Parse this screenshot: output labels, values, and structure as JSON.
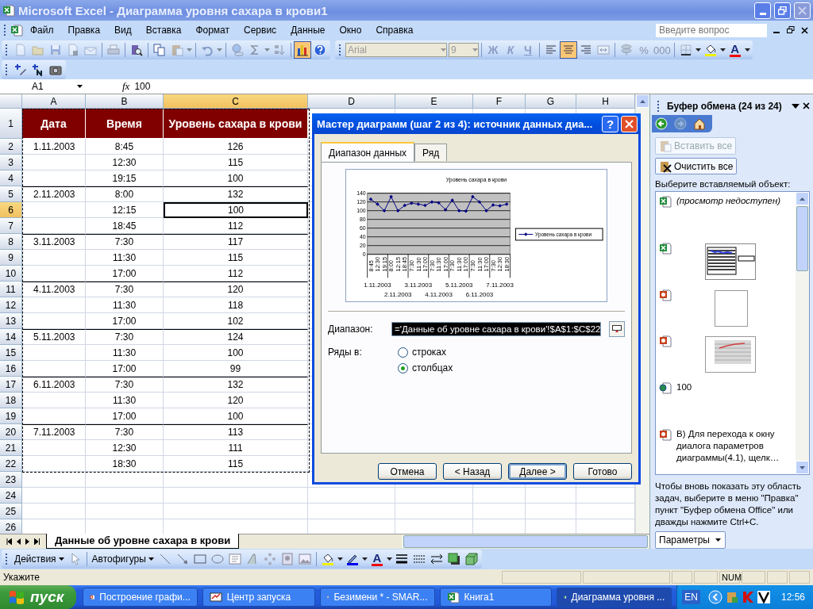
{
  "window": {
    "title": "Microsoft Excel - Диаграмма уровня сахара в крови1"
  },
  "menu": {
    "items": [
      "Файл",
      "Правка",
      "Вид",
      "Вставка",
      "Формат",
      "Сервис",
      "Данные",
      "Окно",
      "Справка"
    ],
    "help_search": {
      "placeholder": "Введите вопрос"
    }
  },
  "standard_toolbar": {
    "groups": [
      [
        {
          "kind": "new",
          "pressed": false,
          "disabled": true
        },
        {
          "kind": "open",
          "pressed": false,
          "disabled": true
        },
        {
          "kind": "save",
          "pressed": false,
          "disabled": true
        },
        {
          "kind": "permission",
          "pressed": false,
          "disabled": true
        },
        {
          "kind": "email",
          "pressed": false,
          "disabled": true
        }
      ],
      [
        {
          "kind": "print",
          "pressed": false,
          "disabled": true
        }
      ],
      [
        {
          "kind": "research",
          "pressed": false,
          "disabled": false
        }
      ],
      [
        {
          "kind": "copy",
          "pressed": false,
          "disabled": false
        },
        {
          "kind": "paste",
          "pressed": false,
          "disabled": true
        },
        {
          "kind": "caret",
          "pressed": false,
          "disabled": true
        }
      ],
      [
        {
          "kind": "undo",
          "pressed": false,
          "disabled": true
        },
        {
          "kind": "caret",
          "pressed": false,
          "disabled": true
        }
      ],
      [
        {
          "kind": "link",
          "pressed": false,
          "disabled": true
        },
        {
          "kind": "sum",
          "pressed": false,
          "disabled": true
        },
        {
          "kind": "caret",
          "pressed": false,
          "disabled": true
        },
        {
          "kind": "sort",
          "pressed": false,
          "disabled": true
        }
      ],
      [
        {
          "kind": "chart",
          "pressed": true,
          "disabled": false
        },
        {
          "kind": "help",
          "pressed": false,
          "disabled": false
        }
      ]
    ]
  },
  "formatting_toolbar": {
    "font": {
      "value": "Arial",
      "disabled": true
    },
    "size": {
      "value": "9",
      "disabled": true
    },
    "groups": [
      [
        {
          "kind": "bold",
          "label": "Ж",
          "pressed": false,
          "disabled": true
        },
        {
          "kind": "italic",
          "label": "К",
          "pressed": false,
          "disabled": true
        },
        {
          "kind": "underline",
          "label": "Ч",
          "pressed": false,
          "disabled": true
        }
      ],
      [
        {
          "kind": "align-left",
          "pressed": false,
          "disabled": false
        },
        {
          "kind": "align-center",
          "pressed": true,
          "disabled": false
        },
        {
          "kind": "align-right",
          "pressed": false,
          "disabled": false
        },
        {
          "kind": "merge",
          "pressed": false,
          "disabled": true
        }
      ],
      [
        {
          "kind": "currency",
          "pressed": false,
          "disabled": true
        },
        {
          "kind": "percent",
          "label": "%",
          "pressed": false,
          "disabled": true
        },
        {
          "kind": "thousands",
          "label": "000",
          "pressed": false,
          "disabled": true
        }
      ],
      [
        {
          "kind": "borders",
          "pressed": false,
          "disabled": false
        },
        {
          "kind": "caret",
          "pressed": false,
          "disabled": false
        },
        {
          "kind": "fill",
          "pressed": false,
          "disabled": false
        },
        {
          "kind": "caret",
          "pressed": false,
          "disabled": false
        },
        {
          "kind": "font-color",
          "label": "A",
          "pressed": false,
          "disabled": false
        },
        {
          "kind": "caret",
          "pressed": false,
          "disabled": false
        }
      ]
    ]
  },
  "review_toolbar": {
    "items": [
      {
        "kind": "pen-plus"
      },
      {
        "kind": "note-plus"
      },
      {
        "kind": "camera"
      }
    ]
  },
  "formula_bar": {
    "name_box": "A1",
    "fx": "fx",
    "value": "100"
  },
  "sheet": {
    "columns": [
      "A",
      "B",
      "C",
      "D",
      "E",
      "F",
      "G",
      "H"
    ],
    "row_numbers": [
      "1",
      "2",
      "3",
      "4",
      "5",
      "6",
      "7",
      "8",
      "9",
      "10",
      "11",
      "12",
      "13",
      "14",
      "15",
      "16",
      "17",
      "18",
      "19",
      "20",
      "21",
      "22",
      "23",
      "24",
      "25",
      "26"
    ],
    "header": [
      "Дата",
      "Время",
      "Уровень сахара в крови"
    ],
    "data": [
      {
        "date": "1.11.2003",
        "time": "8:45",
        "sugar": "126",
        "selected": false
      },
      {
        "time": "12:30",
        "sugar": "115",
        "selected": false
      },
      {
        "time": "19:15",
        "sugar": "100",
        "selected": false
      },
      {
        "date": "2.11.2003",
        "time": "8:00",
        "sugar": "132",
        "selected": false
      },
      {
        "time": "12:15",
        "sugar": "100",
        "selected": true
      },
      {
        "time": "18:45",
        "sugar": "112",
        "selected": false
      },
      {
        "date": "3.11.2003",
        "time": "7:30",
        "sugar": "117",
        "selected": false
      },
      {
        "time": "11:30",
        "sugar": "115",
        "selected": false
      },
      {
        "time": "17:00",
        "sugar": "112",
        "selected": false
      },
      {
        "date": "4.11.2003",
        "time": "7:30",
        "sugar": "120",
        "selected": false
      },
      {
        "time": "11:30",
        "sugar": "118",
        "selected": false
      },
      {
        "time": "17:00",
        "sugar": "102",
        "selected": false
      },
      {
        "date": "5.11.2003",
        "time": "7:30",
        "sugar": "124",
        "selected": false
      },
      {
        "time": "11:30",
        "sugar": "100",
        "selected": false
      },
      {
        "time": "17:00",
        "sugar": "99",
        "selected": false
      },
      {
        "date": "6.11.2003",
        "time": "7:30",
        "sugar": "132",
        "selected": false
      },
      {
        "time": "11:30",
        "sugar": "120",
        "selected": false
      },
      {
        "time": "17:00",
        "sugar": "100",
        "selected": false
      },
      {
        "date": "7.11.2003",
        "time": "7:30",
        "sugar": "113",
        "selected": false
      },
      {
        "time": "12:30",
        "sugar": "111",
        "selected": false
      },
      {
        "time": "18:30",
        "sugar": "115",
        "selected": false
      }
    ],
    "copy_marquee": true,
    "tabs": [
      {
        "label": "Данные об уровне сахара в крови",
        "selected": true
      }
    ]
  },
  "dialog": {
    "title": "Мастер диаграмм (шаг 2 из 4): источник данных диа...",
    "help": "?",
    "tabs": [
      {
        "label": "Диапазон данных",
        "selected": true
      },
      {
        "label": "Ряд",
        "selected": false
      }
    ],
    "chart_data": {
      "type": "line",
      "title": "Уровень сахара в крови",
      "categories": [
        "8:45",
        "12:30",
        "19:15",
        "8:00",
        "12:15",
        "18:45",
        "7:30",
        "11:30",
        "17:00",
        "7:30",
        "11:30",
        "17:00",
        "7:30",
        "11:30",
        "17:00",
        "7:30",
        "11:30",
        "17:00",
        "7:30",
        "12:30",
        "18:30"
      ],
      "grid": true,
      "series": [
        {
          "name": "Уровень сахара в крови",
          "color": "#000080",
          "marker": "diamond",
          "values": [
            126,
            115,
            100,
            132,
            100,
            112,
            117,
            115,
            112,
            120,
            118,
            102,
            124,
            100,
            99,
            132,
            120,
            100,
            113,
            111,
            115
          ]
        }
      ],
      "ylim": [
        0,
        140
      ],
      "yticks": [
        0,
        20,
        40,
        60,
        80,
        100,
        120,
        140
      ]
    },
    "date_labels": [
      "1.11.2003",
      "2.11.2003",
      "3.11.2003",
      "4.11.2003",
      "5.11.2003",
      "6.11.2003",
      "7.11.2003"
    ],
    "range_label": "Диапазон:",
    "range_value": "='Данные об уровне сахара в крови'!$A$1:$C$22",
    "series_in_label": "Ряды в:",
    "series_in": [
      {
        "label": "строках",
        "selected": false
      },
      {
        "label": "столбцах",
        "selected": true
      }
    ],
    "buttons": [
      {
        "label": "Отмена",
        "focused": false
      },
      {
        "label": "< Назад",
        "focused": false
      },
      {
        "label": "Далее >",
        "focused": true
      },
      {
        "label": "Готово",
        "focused": false
      }
    ]
  },
  "task_pane": {
    "title": "Буфер обмена (24 из 24)",
    "nav": [
      {
        "kind": "back",
        "disabled": false
      },
      {
        "kind": "forward",
        "disabled": true
      },
      {
        "kind": "home",
        "disabled": false
      }
    ],
    "buttons": [
      {
        "kind": "paste",
        "label": "Вставить все",
        "disabled": true
      },
      {
        "kind": "clear",
        "label": "Очистить все",
        "disabled": false
      }
    ],
    "prompt": "Выберите вставляемый объект:",
    "items": [
      {
        "kind": "excel-placeholder",
        "text": "(просмотр недоступен)"
      },
      {
        "kind": "excel-tablechart"
      },
      {
        "kind": "powerpoint-blank"
      },
      {
        "kind": "powerpoint-linechart"
      },
      {
        "kind": "web-text",
        "text": "100"
      },
      {
        "kind": "powerpoint-text",
        "text": "В) Для перехода к окну диалога параметров диаграммы(4.1), щелк…"
      }
    ],
    "hint": "Чтобы вновь показать эту область задач, выберите в меню \"Правка\" пункт \"Буфер обмена Office\" или дважды нажмите Ctrl+C.",
    "options_button": "Параметры"
  },
  "drawing_toolbar": {
    "groups": [
      [
        {
          "kind": "menu",
          "label": "Действия"
        },
        {
          "kind": "pointer"
        }
      ],
      [
        {
          "kind": "menu",
          "label": "Автофигуры"
        },
        {
          "kind": "line"
        },
        {
          "kind": "arrow"
        },
        {
          "kind": "rect"
        },
        {
          "kind": "ellipse"
        },
        {
          "kind": "textbox"
        },
        {
          "kind": "wordart"
        },
        {
          "kind": "diagram"
        },
        {
          "kind": "clipart"
        },
        {
          "kind": "picture"
        }
      ],
      [
        {
          "kind": "fill"
        },
        {
          "kind": "caret"
        },
        {
          "kind": "line-color"
        },
        {
          "kind": "caret"
        },
        {
          "kind": "font-color",
          "label": "A"
        },
        {
          "kind": "caret"
        },
        {
          "kind": "line-style"
        },
        {
          "kind": "dash"
        },
        {
          "kind": "arrows"
        },
        {
          "kind": "shadow"
        },
        {
          "kind": "cube"
        }
      ]
    ]
  },
  "status_bar": {
    "text": "Укажите",
    "indicator": "NUM"
  },
  "taskbar": {
    "start": "пуск",
    "items": [
      {
        "label": "Построение графи...",
        "kind": "powerpoint",
        "selected": false
      },
      {
        "label": "Центр запуска",
        "kind": "launcher",
        "selected": false
      },
      {
        "label": "Безимени * - SMAR...",
        "kind": "drawing",
        "selected": false
      },
      {
        "label": "Книга1",
        "kind": "excel",
        "selected": false
      },
      {
        "label": "Диаграмма уровня ...",
        "kind": "excel",
        "selected": true
      }
    ],
    "language": "EN",
    "clock": "12:56"
  }
}
